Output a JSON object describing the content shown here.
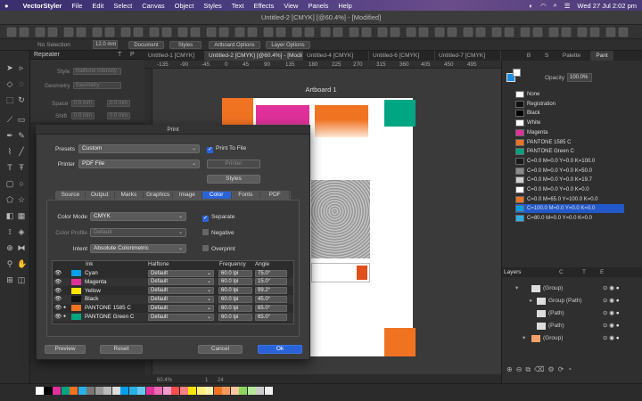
{
  "menubar": {
    "app": "VectorStyler",
    "items": [
      "File",
      "Edit",
      "Select",
      "Canvas",
      "Object",
      "Styles",
      "Text",
      "Effects",
      "View",
      "Panels",
      "Help"
    ],
    "clock": "Wed 27 Jul  2:02 pm"
  },
  "window": {
    "title": "Untitled-2 [CMYK] [@60.4%] - [Modified]"
  },
  "context": {
    "selection": "No Selection",
    "size": "12.0 mm",
    "buttons": [
      "Document",
      "Styles",
      "Artboard Options",
      "Layer Options"
    ]
  },
  "left_panel": {
    "tabs": [
      "Repeater",
      "T",
      "P"
    ],
    "style_label": "Style",
    "style_value": "Halftone intensity",
    "geometry_label": "Geometry",
    "geometry_value": "Geometry",
    "space_label": "Space",
    "space_a": "0.0 mm",
    "space_b": "0.0 mm",
    "shift_label": "Shift",
    "shift_a": "0.0 mm",
    "shift_b": "0.0 mm"
  },
  "doc_tabs": [
    "Untitled-1 [CMYK]",
    "Untitled-2 [CMYK] [@60.4%] - [Modified]",
    "Untitled-4 [CMYK]",
    "Untitled-6 [CMYK]",
    "Untitled-7 [CMYK]"
  ],
  "ruler_ticks": [
    "-135",
    "-90",
    "-45",
    "0",
    "45",
    "90",
    "135",
    "180",
    "225",
    "270",
    "315",
    "360",
    "405",
    "450",
    "495"
  ],
  "artboard": {
    "title": "Artboard 1"
  },
  "right_panel": {
    "tabs": [
      "B",
      "S",
      "Palette",
      "Pant"
    ],
    "opacity_label": "Opacity",
    "opacity_value": "100.0%",
    "swatches": [
      {
        "name": "None",
        "color": "#ffffff"
      },
      {
        "name": "Registration",
        "color": "#111111"
      },
      {
        "name": "Black",
        "color": "#000000"
      },
      {
        "name": "White",
        "color": "#ffffff"
      },
      {
        "name": "Magenta",
        "color": "#e0319a"
      },
      {
        "name": "PANTONE 1585 C",
        "color": "#f07322"
      },
      {
        "name": "PANTONE Green C",
        "color": "#00a582"
      },
      {
        "name": "C=0.0 M=0.0 Y=0.0 K=100.0",
        "color": "#1a1a1a"
      },
      {
        "name": "C=0.0 M=0.0 Y=0.0 K=50.0",
        "color": "#8a8a8a"
      },
      {
        "name": "C=0.0 M=0.0 Y=0.0 K=19.7",
        "color": "#cfcfcf"
      },
      {
        "name": "C=0.0 M=0.0 Y=0.0 K=0.0",
        "color": "#ffffff"
      },
      {
        "name": "C=0.0 M=65.0 Y=100.0 K=0.0",
        "color": "#f07322"
      },
      {
        "name": "C=100.0 M=0.0 Y=0.0 K=0.0",
        "color": "#00a0e8"
      },
      {
        "name": "C=80.0 M=0.0 Y=0.0 K=0.0",
        "color": "#2ab0e6"
      }
    ],
    "selected_swatch": 12
  },
  "layers": {
    "tabs": [
      "Layers",
      "C",
      "T",
      "E"
    ],
    "items": [
      "(Group)",
      "Group (Path)",
      "(Path)",
      "(Path)",
      "(Group)"
    ]
  },
  "print_dialog": {
    "title": "Print",
    "presets_label": "Presets",
    "presets_value": "Custom",
    "print_to_file_label": "Print To File",
    "printer_label": "Printer",
    "printer_value": "PDF File",
    "printer_button": "Printer",
    "styles_button": "Styles",
    "tabs": [
      "Source",
      "Output",
      "Marks",
      "Graphics",
      "Image",
      "Color",
      "Fonts",
      "PDF"
    ],
    "active_tab": "Color",
    "color_mode_label": "Color Mode",
    "color_mode_value": "CMYK",
    "color_profile_label": "Color Profile",
    "color_profile_value": "Default",
    "intent_label": "Intent",
    "intent_value": "Absolute Colorimetric",
    "separate_label": "Separate",
    "negative_label": "Negative",
    "overprint_label": "Overprint",
    "ink_headers": {
      "ink": "Ink",
      "halftone": "Halftone",
      "frequency": "Frequency",
      "angle": "Angle"
    },
    "inks": [
      {
        "name": "Cyan",
        "color": "#00a0e8",
        "halftone": "Default",
        "frequency": "60.0 lpi",
        "angle": "75.0°"
      },
      {
        "name": "Magenta",
        "color": "#e0319a",
        "halftone": "Default",
        "frequency": "60.0 lpi",
        "angle": "15.0°"
      },
      {
        "name": "Yellow",
        "color": "#ffe600",
        "halftone": "Default",
        "frequency": "60.0 lpi",
        "angle": "99.2°"
      },
      {
        "name": "Black",
        "color": "#111111",
        "halftone": "Default",
        "frequency": "60.0 lpi",
        "angle": "45.0°"
      },
      {
        "name": "PANTONE 1585 C",
        "color": "#f07322",
        "halftone": "Default",
        "frequency": "60.0 lpi",
        "angle": "65.0°"
      },
      {
        "name": "PANTONE Green C",
        "color": "#00a582",
        "halftone": "Default",
        "frequency": "60.0 lpi",
        "angle": "65.0°"
      }
    ],
    "preview_button": "Preview",
    "reset_button": "Reset",
    "cancel_button": "Cancel",
    "ok_button": "Ok"
  },
  "status": {
    "zoom": "60.4%",
    "page": "1",
    "count": "24"
  }
}
